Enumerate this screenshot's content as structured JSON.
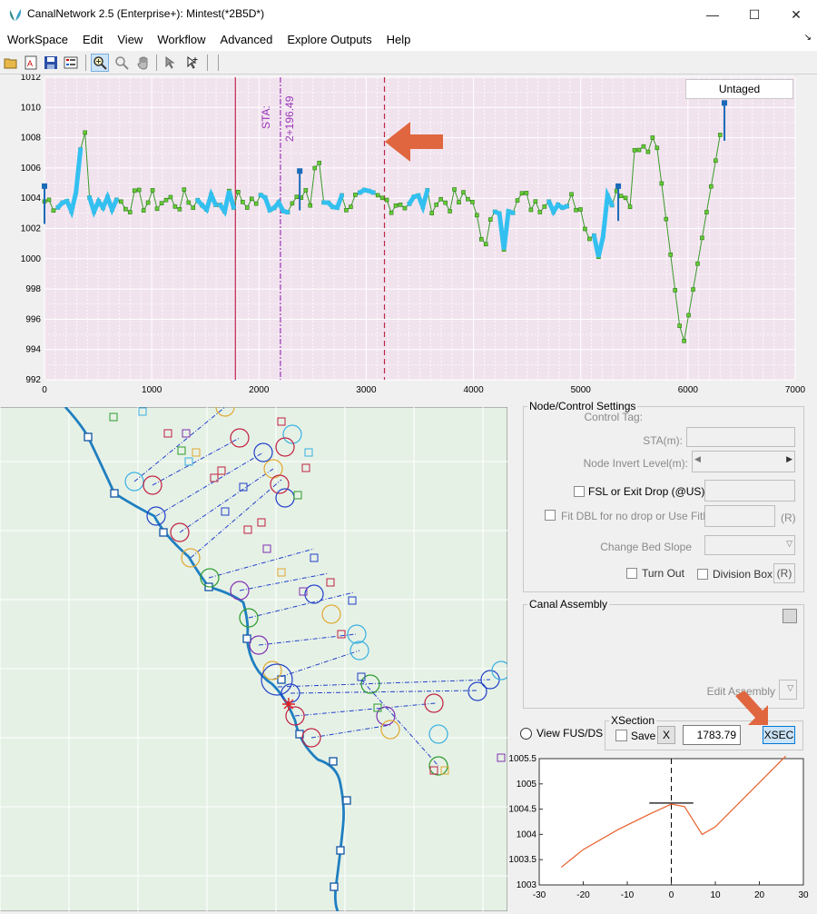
{
  "window": {
    "title": "CanalNetwork 2.5  (Enterprise+): Mintest(*2B5D*)",
    "minimize": "—",
    "maximize": "☐",
    "close": "✕"
  },
  "menu": [
    "WorkSpace",
    "Edit",
    "View",
    "Workflow",
    "Advanced",
    "Explore Outputs",
    "Help"
  ],
  "toolbar_icons": [
    "open-folder-icon",
    "text-edit-icon",
    "save-icon",
    "list-icon",
    "zoom-in-icon",
    "zoom-icon",
    "pan-hand-icon",
    "select-node-icon",
    "add-node-icon"
  ],
  "profile": {
    "untagged_label": "Untaged",
    "sta_label": "STA:",
    "sta_value": "2+196.49",
    "y_ticks": [
      "992",
      "994",
      "996",
      "998",
      "1000",
      "1002",
      "1004",
      "1006",
      "1008",
      "1010",
      "1012"
    ],
    "x_ticks": [
      "0",
      "1000",
      "2000",
      "3000",
      "4000",
      "5000",
      "6000",
      "7000"
    ],
    "xlim": [
      0,
      7000
    ],
    "ylim": [
      992,
      1012
    ],
    "red_line_x": 1780,
    "purple_line_x": 2200,
    "dashed_red_x": 3170,
    "arrow_color": "#e0663f"
  },
  "node_settings": {
    "legend": "Node/Control Settings",
    "control_tag": "Control Tag:",
    "sta": "STA(m):",
    "node_invert": "Node Invert Level(m):",
    "fsl": "FSL or Exit Drop (@US)",
    "fit_dbl": "Fit DBL for no drop or Use FitHt:",
    "fit_r": "(R)",
    "change_bed": "Change Bed Slope",
    "turn_out": "Turn Out",
    "division_box": "Division Box",
    "division_r": "(R)"
  },
  "canal_assembly": {
    "legend": "Canal Assembly",
    "edit_assembly": "Edit Assembly"
  },
  "view_fus": "View FUS/DS",
  "xsection": {
    "legend": "XSection",
    "save": "Save",
    "x_button": "X",
    "value": "1783.79",
    "xsec_button": "XSEC"
  },
  "chart_data": {
    "type": "line",
    "x": [
      -25,
      -20,
      -12,
      -5,
      0,
      3,
      7,
      10,
      26
    ],
    "y": [
      1003.35,
      1003.7,
      1004.1,
      1004.4,
      1004.6,
      1004.55,
      1004.0,
      1004.15,
      1005.55
    ],
    "xlim": [
      -30,
      30
    ],
    "ylim": [
      1003,
      1005.5
    ],
    "x_ticks": [
      "-30",
      "-20",
      "-10",
      "0",
      "10",
      "20",
      "30"
    ],
    "y_ticks": [
      "1003",
      "1003.5",
      "1004",
      "1004.5",
      "1005",
      "1005.5"
    ],
    "color": "#e8602c",
    "level_line": {
      "x1": -5,
      "x2": 5,
      "y": 1004.62
    }
  }
}
